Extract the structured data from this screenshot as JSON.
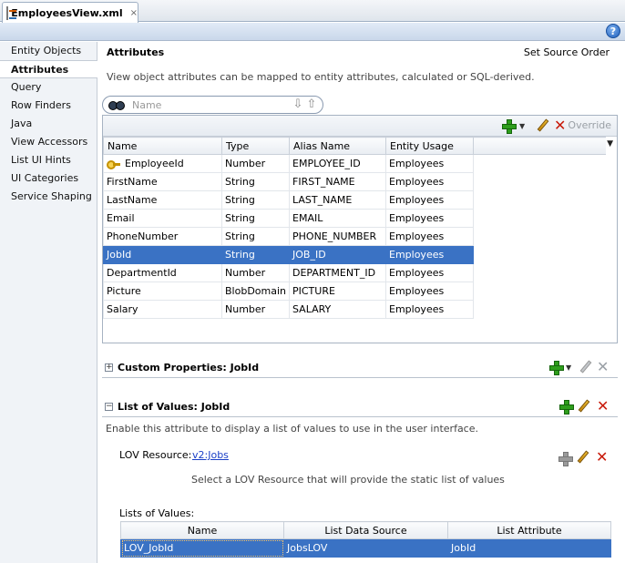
{
  "tab": {
    "title": "EmployeesView.xml",
    "close": "×"
  },
  "help": "?",
  "nav": [
    {
      "label": "Entity Objects"
    },
    {
      "label": "Attributes"
    },
    {
      "label": "Query"
    },
    {
      "label": "Row Finders"
    },
    {
      "label": "Java"
    },
    {
      "label": "View Accessors"
    },
    {
      "label": "List UI Hints"
    },
    {
      "label": "UI Categories"
    },
    {
      "label": "Service Shaping"
    }
  ],
  "main": {
    "title": "Attributes",
    "set_source_order": "Set Source Order",
    "description": "View object attributes can be mapped to entity attributes, calculated or SQL-derived.",
    "search_placeholder": "Name",
    "override": "Override"
  },
  "attributes": {
    "columns": [
      "Name",
      "Type",
      "Alias Name",
      "Entity Usage"
    ],
    "rows": [
      [
        "EmployeeId",
        "Number",
        "EMPLOYEE_ID",
        "Employees"
      ],
      [
        "FirstName",
        "String",
        "FIRST_NAME",
        "Employees"
      ],
      [
        "LastName",
        "String",
        "LAST_NAME",
        "Employees"
      ],
      [
        "Email",
        "String",
        "EMAIL",
        "Employees"
      ],
      [
        "PhoneNumber",
        "String",
        "PHONE_NUMBER",
        "Employees"
      ],
      [
        "JobId",
        "String",
        "JOB_ID",
        "Employees"
      ],
      [
        "DepartmentId",
        "Number",
        "DEPARTMENT_ID",
        "Employees"
      ],
      [
        "Picture",
        "BlobDomain",
        "PICTURE",
        "Employees"
      ],
      [
        "Salary",
        "Number",
        "SALARY",
        "Employees"
      ]
    ]
  },
  "custom_properties": {
    "title": "Custom Properties: JobId",
    "expander": "+"
  },
  "lov": {
    "title": "List of Values: JobId",
    "expander": "−",
    "description": "Enable this attribute to display a list of values to use in the user interface.",
    "resource_label": "LOV Resource:",
    "resource_value": "v2:Jobs",
    "hint": "Select a LOV Resource that will provide the static list of values",
    "lists_label": "Lists of Values:",
    "columns": [
      "Name",
      "List Data Source",
      "List Attribute"
    ],
    "rows": [
      [
        "LOV_JobId",
        "JobsLOV",
        "JobId"
      ]
    ]
  }
}
